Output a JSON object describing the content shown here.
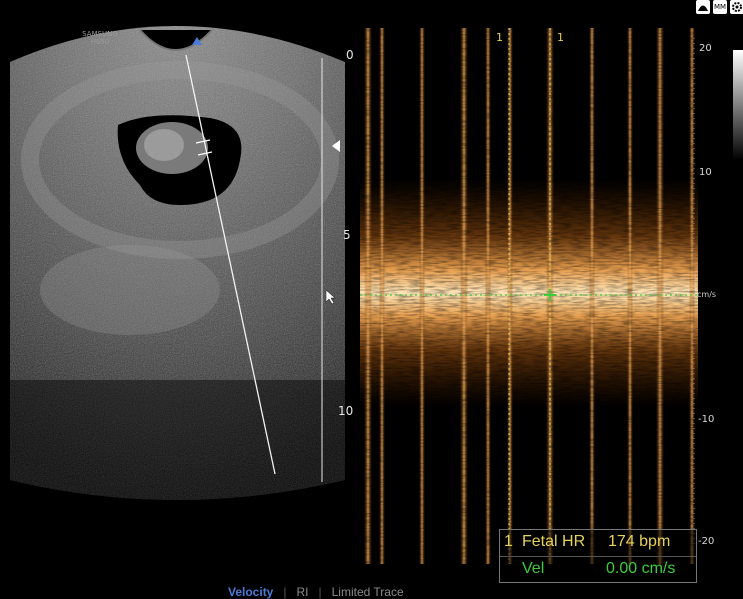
{
  "device": {
    "brand": "SAMSUNG",
    "model": "HS50"
  },
  "bmode": {
    "depth_labels": [
      "0",
      "5",
      "10"
    ]
  },
  "doppler": {
    "velocity_scale": [
      "20",
      "10",
      "cm/s",
      "-10",
      "-20"
    ],
    "caliper_labels": [
      "1",
      "1"
    ]
  },
  "measurement": {
    "index": "1",
    "label": "Fetal HR",
    "value": "174 bpm",
    "velocity_label": "Vel",
    "velocity_value": "0.00 cm/s"
  },
  "footer_menu": {
    "items": [
      {
        "label": "Velocity",
        "active": true
      },
      {
        "label": "RI",
        "active": false
      },
      {
        "label": "Limited Trace",
        "active": false
      }
    ],
    "separator": "|"
  },
  "top_icons": [
    "patient-icon",
    "mm-icon",
    "settings-icon"
  ],
  "top_icon_labels": [
    "MM"
  ],
  "colors": {
    "doppler_spectrum": "#f0a64c",
    "measurement_text": "#e6d25a",
    "velocity_text": "#3ccd3c",
    "active_tab": "#4a7bd9"
  }
}
